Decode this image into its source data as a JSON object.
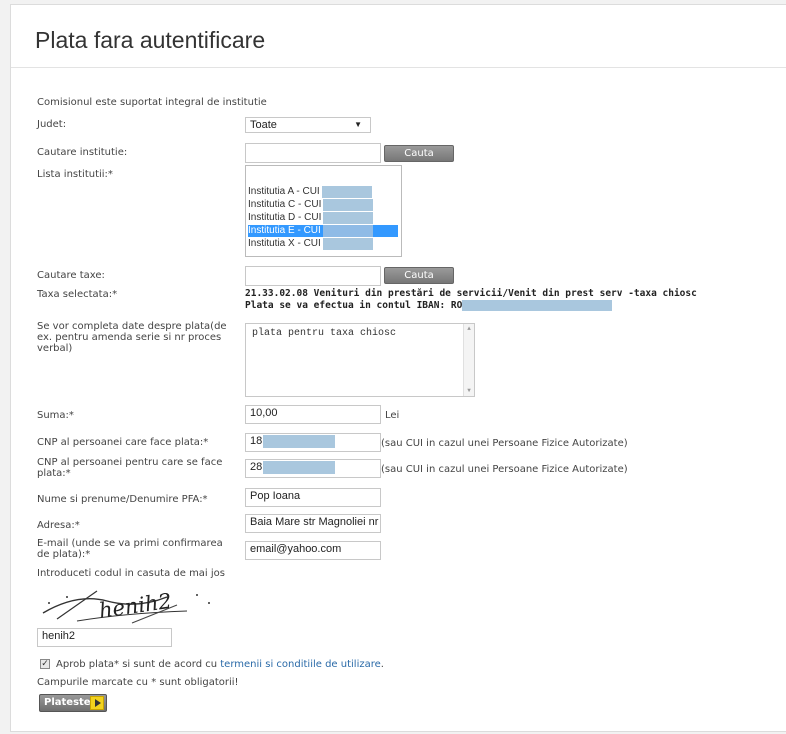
{
  "page": {
    "title": "Plata fara autentificare"
  },
  "form": {
    "commission_note": "Comisionul este suportat integral de institutie",
    "judet": {
      "label": "Judet:",
      "value": "Toate"
    },
    "search_institution": {
      "label": "Cautare institutie:",
      "value": "",
      "button": "Cauta"
    },
    "institution_list": {
      "label": "Lista institutii:*",
      "options": [
        "Institutia A - CUI",
        "Institutia C - CUI",
        "Institutia D - CUI",
        "Institutia E - CUI",
        "Institutia X - CUI"
      ],
      "selected": "Institutia E - CUI"
    },
    "search_tax": {
      "label": "Cautare taxe:",
      "value": "",
      "button": "Cauta"
    },
    "selected_tax": {
      "label": "Taxa selectata:*",
      "line1": "21.33.02.08 Venituri din prestări de servicii/Venit din prest serv -taxa chiosc",
      "line2": "Plata se va efectua in contul IBAN: RO"
    },
    "payment_details": {
      "label": "Se vor completa date despre plata(de ex. pentru amenda serie si nr proces verbal)",
      "value": "plata pentru taxa chiosc"
    },
    "amount": {
      "label": "Suma:*",
      "value": "10,00",
      "unit": "Lei"
    },
    "cnp_payer": {
      "label": "CNP al persoanei care face plata:*",
      "value": "18",
      "hint": "(sau CUI in cazul unei Persoane Fizice Autorizate)"
    },
    "cnp_beneficiary": {
      "label": "CNP al persoanei pentru care se face plata:*",
      "value": "28",
      "hint": "(sau CUI in cazul unei Persoane Fizice Autorizate)"
    },
    "name": {
      "label": "Nume si prenume/Denumire PFA:*",
      "value": "Pop Ioana"
    },
    "address": {
      "label": "Adresa:*",
      "value": "Baia Mare str Magnoliei nr"
    },
    "email": {
      "label": "E-mail (unde se va primi confirmarea de plata):*",
      "value": "email@yahoo.com"
    },
    "captcha": {
      "label": "Introduceti codul in casuta de mai jos",
      "image_text": "henih2",
      "value": "henih2"
    },
    "agree": {
      "text_before": "Aprob plata* si sunt de acord cu ",
      "link": "termenii si conditiile de utilizare",
      "text_after": ".",
      "checked": true
    },
    "required_note": "Campurile marcate cu * sunt obligatorii!",
    "pay_button": "Plateste"
  },
  "colors": {
    "accent_link": "#2a6aa8",
    "selection": "#3399ff",
    "redaction": "#a9c7de"
  }
}
